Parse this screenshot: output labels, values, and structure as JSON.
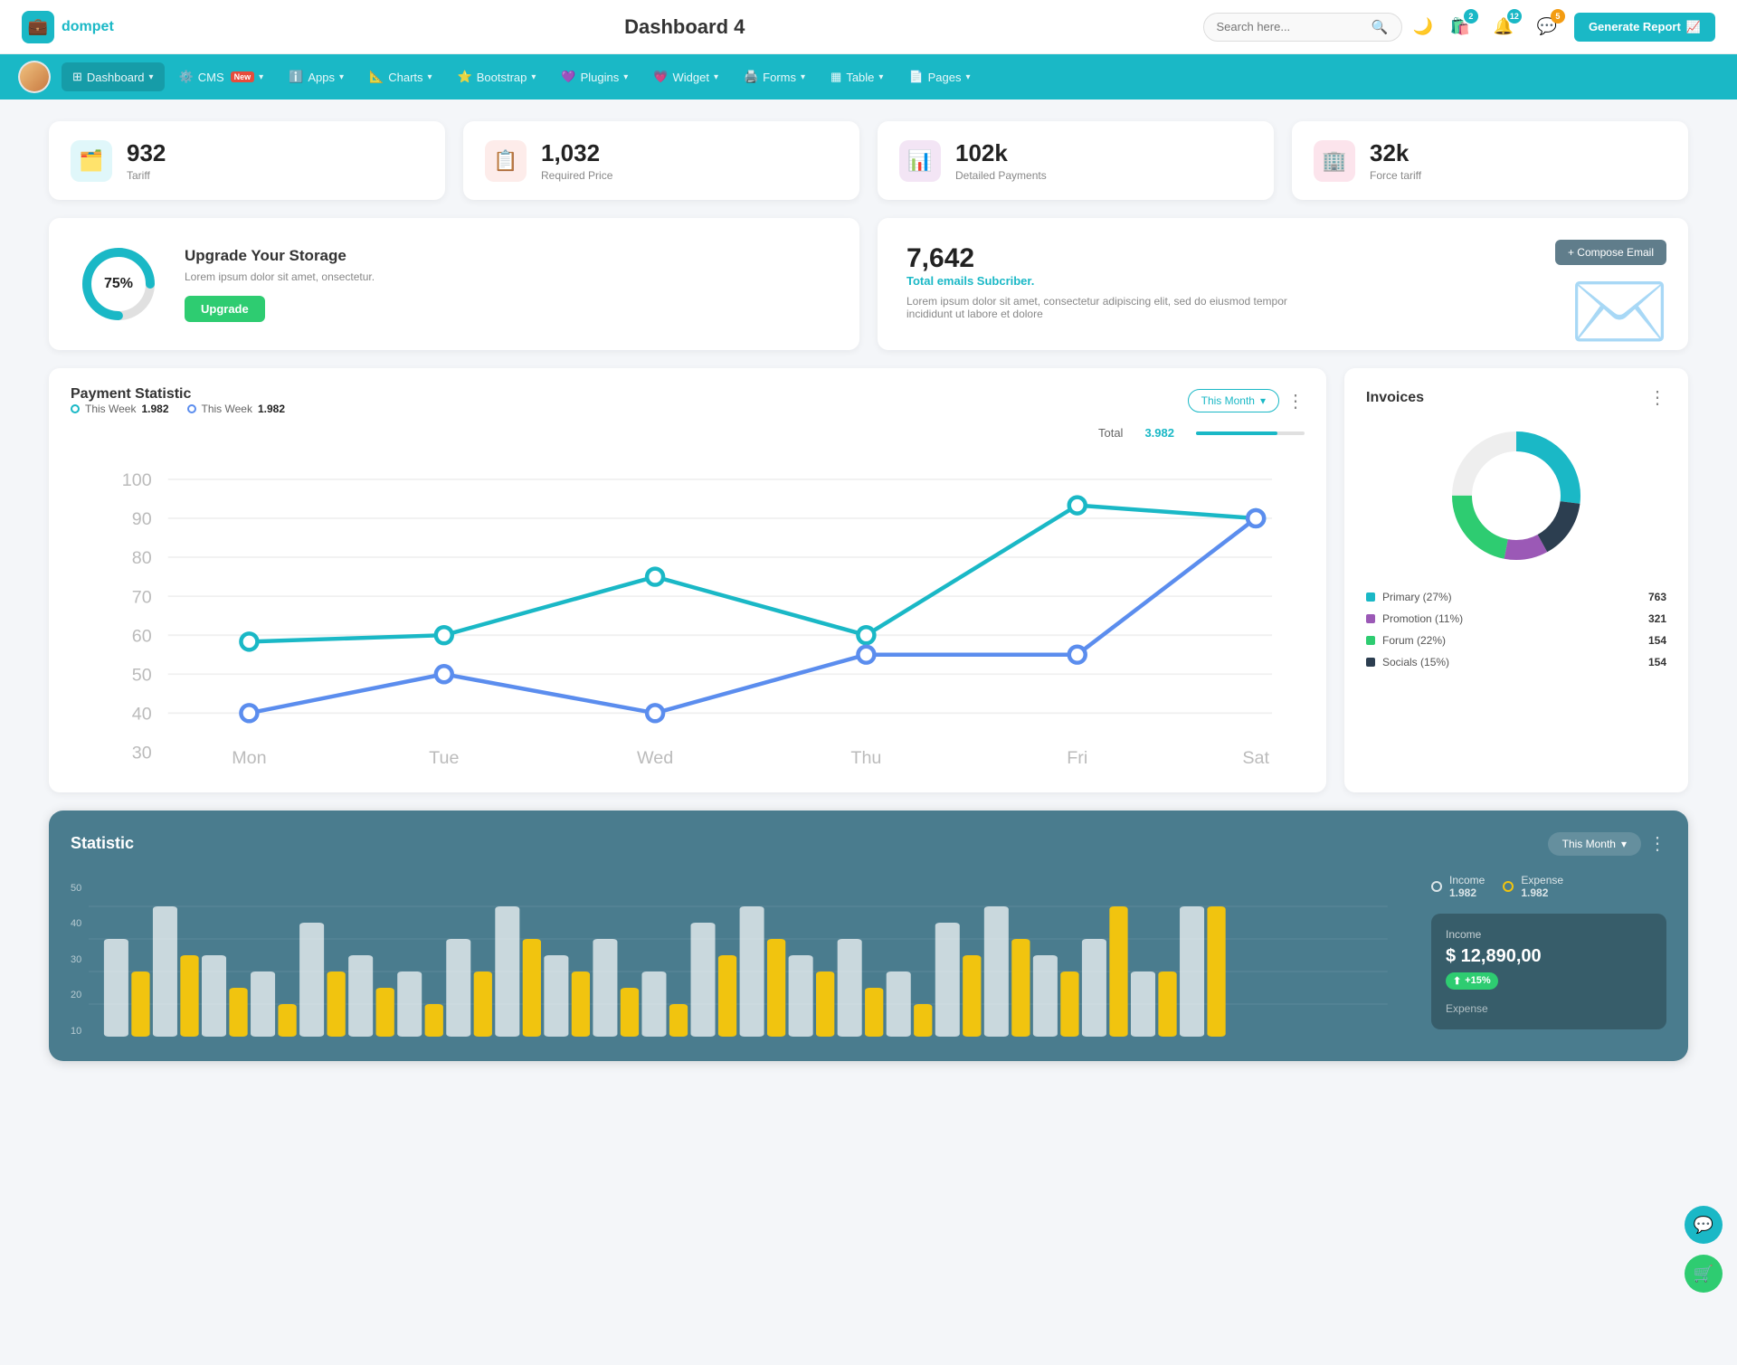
{
  "header": {
    "logo_text": "dompet",
    "page_title": "Dashboard 4",
    "search_placeholder": "Search here...",
    "generate_btn": "Generate Report",
    "badge_shopping": "2",
    "badge_bell": "12",
    "badge_chat": "5"
  },
  "navbar": {
    "items": [
      {
        "id": "dashboard",
        "label": "Dashboard",
        "has_arrow": true,
        "active": true
      },
      {
        "id": "cms",
        "label": "CMS",
        "has_arrow": true,
        "has_new": true
      },
      {
        "id": "apps",
        "label": "Apps",
        "has_arrow": true
      },
      {
        "id": "charts",
        "label": "Charts",
        "has_arrow": true
      },
      {
        "id": "bootstrap",
        "label": "Bootstrap",
        "has_arrow": true
      },
      {
        "id": "plugins",
        "label": "Plugins",
        "has_arrow": true
      },
      {
        "id": "widget",
        "label": "Widget",
        "has_arrow": true
      },
      {
        "id": "forms",
        "label": "Forms",
        "has_arrow": true
      },
      {
        "id": "table",
        "label": "Table",
        "has_arrow": true
      },
      {
        "id": "pages",
        "label": "Pages",
        "has_arrow": true
      }
    ]
  },
  "stat_cards": [
    {
      "id": "tariff",
      "value": "932",
      "label": "Tariff",
      "icon": "🗂️",
      "icon_type": "teal"
    },
    {
      "id": "required-price",
      "value": "1,032",
      "label": "Required Price",
      "icon": "📋",
      "icon_type": "red"
    },
    {
      "id": "detailed-payments",
      "value": "102k",
      "label": "Detailed Payments",
      "icon": "📊",
      "icon_type": "purple"
    },
    {
      "id": "force-tariff",
      "value": "32k",
      "label": "Force tariff",
      "icon": "🏢",
      "icon_type": "pink"
    }
  ],
  "storage": {
    "title": "Upgrade Your Storage",
    "description": "Lorem ipsum dolor sit amet, onsectetur.",
    "percentage": "75%",
    "upgrade_btn": "Upgrade"
  },
  "email": {
    "number": "7,642",
    "subtitle": "Total emails Subcriber.",
    "description": "Lorem ipsum dolor sit amet, consectetur adipiscing elit, sed do eiusmod tempor incididunt ut labore et dolore",
    "compose_btn": "+ Compose Email"
  },
  "payment_chart": {
    "title": "Payment Statistic",
    "period_btn": "This Month",
    "more_btn": "⋮",
    "legend": [
      {
        "label": "This Week",
        "value": "1.982",
        "type": "teal"
      },
      {
        "label": "This Week",
        "value": "1.982",
        "type": "blue"
      }
    ],
    "total_label": "Total",
    "total_value": "3.982",
    "x_labels": [
      "Mon",
      "Tue",
      "Wed",
      "Thu",
      "Fri",
      "Sat"
    ],
    "y_labels": [
      "100",
      "90",
      "80",
      "70",
      "60",
      "50",
      "40",
      "30"
    ]
  },
  "invoices": {
    "title": "Invoices",
    "more_btn": "⋮",
    "legend": [
      {
        "label": "Primary (27%)",
        "value": "763",
        "color": "#1ab8c6"
      },
      {
        "label": "Promotion (11%)",
        "value": "321",
        "color": "#9b59b6"
      },
      {
        "label": "Forum (22%)",
        "value": "154",
        "color": "#2ecc71"
      },
      {
        "label": "Socials (15%)",
        "value": "154",
        "color": "#2c3e50"
      }
    ]
  },
  "statistic": {
    "title": "Statistic",
    "period_btn": "This Month",
    "more_btn": "⋮",
    "income_label": "Income",
    "income_value": "1.982",
    "expense_label": "Expense",
    "expense_value": "1.982",
    "y_labels": [
      "50",
      "40",
      "30",
      "20",
      "10"
    ],
    "income_detail": {
      "label": "Income",
      "value": "$ 12,890,00",
      "change": "+15%"
    },
    "expense_detail": {
      "label": "Expense"
    }
  }
}
